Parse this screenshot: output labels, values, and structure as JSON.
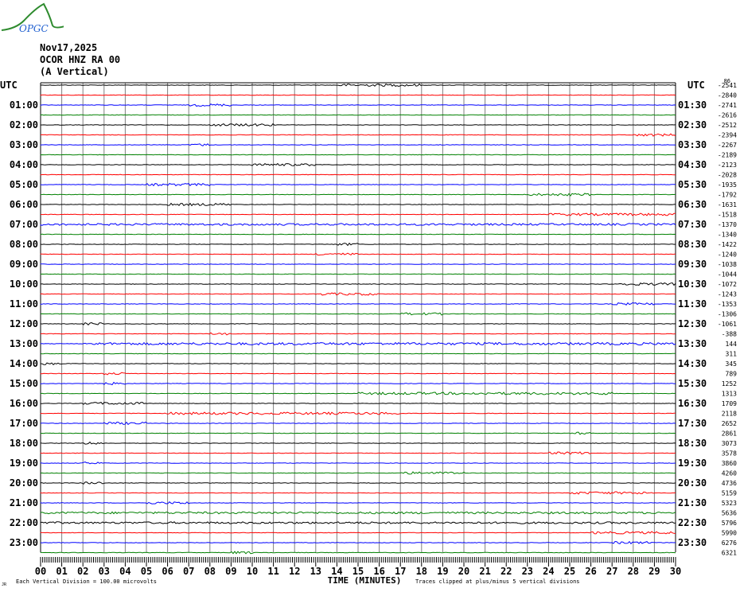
{
  "logo_text": "OPGC",
  "header": {
    "date": "Nov17,2025",
    "station": "OCOR HNZ RA 00",
    "component": "(A Vertical)",
    "utc_left": "UTC",
    "utc_right": "UTC"
  },
  "colors": {
    "trace_cycle": [
      "#000000",
      "#ff0000",
      "#0000ff",
      "#008000"
    ],
    "grid": "#808080"
  },
  "chart_data": {
    "type": "line",
    "title": "Nov17,2025 OCOR HNZ RA 00 (A Vertical)",
    "xlabel": "TIME (MINUTES)",
    "xlim": [
      0,
      30
    ],
    "x_ticks": [
      "00",
      "01",
      "02",
      "03",
      "04",
      "05",
      "06",
      "07",
      "08",
      "09",
      "10",
      "11",
      "12",
      "13",
      "14",
      "15",
      "16",
      "17",
      "18",
      "19",
      "20",
      "21",
      "22",
      "23",
      "24",
      "25",
      "26",
      "27",
      "28",
      "29",
      "30"
    ],
    "left_labels": [
      "01:00",
      "02:00",
      "03:00",
      "04:00",
      "05:00",
      "06:00",
      "07:00",
      "08:00",
      "09:00",
      "10:00",
      "11:00",
      "12:00",
      "13:00",
      "14:00",
      "15:00",
      "16:00",
      "17:00",
      "18:00",
      "19:00",
      "20:00",
      "21:00",
      "22:00",
      "23:00"
    ],
    "right_labels": [
      "01:30",
      "02:30",
      "03:30",
      "04:30",
      "05:30",
      "06:30",
      "07:30",
      "08:30",
      "09:30",
      "10:30",
      "11:30",
      "12:30",
      "13:30",
      "14:30",
      "15:30",
      "16:30",
      "17:30",
      "18:30",
      "19:30",
      "20:30",
      "21:30",
      "22:30",
      "23:30"
    ],
    "top_right_extra": "86",
    "trace_offsets": [
      -2541,
      -2840,
      -2741,
      -2616,
      -2512,
      -2394,
      -2267,
      -2189,
      -2123,
      -2028,
      -1935,
      -1792,
      -1631,
      -1518,
      -1370,
      -1340,
      -1422,
      -1240,
      -1038,
      -1044,
      -1072,
      -1243,
      -1353,
      -1306,
      -1061,
      -388,
      144,
      311,
      345,
      789,
      1252,
      1313,
      1709,
      2118,
      2652,
      2861,
      3073,
      3578,
      3860,
      4260,
      4736,
      5159,
      5323,
      5636,
      5796,
      5990,
      6276,
      6321
    ],
    "footer_left": "Each Vertical Division =  100.00 microvolts",
    "footer_right": "Traces clipped at plus/minus 5 vertical divisions",
    "corner_mark": "JR",
    "busy_traces": [
      14,
      43,
      44,
      48
    ],
    "events": [
      [
        0,
        14,
        18
      ],
      [
        2,
        7,
        9
      ],
      [
        4,
        8,
        11
      ],
      [
        5,
        28,
        30
      ],
      [
        6,
        7,
        8
      ],
      [
        8,
        10,
        13
      ],
      [
        10,
        5,
        8
      ],
      [
        11,
        23,
        26
      ],
      [
        12,
        6,
        9
      ],
      [
        13,
        24,
        30
      ],
      [
        16,
        14,
        15
      ],
      [
        17,
        13,
        15
      ],
      [
        20,
        27,
        30
      ],
      [
        21,
        13,
        16
      ],
      [
        22,
        27,
        29
      ],
      [
        23,
        17,
        19
      ],
      [
        24,
        2,
        3
      ],
      [
        25,
        8,
        9
      ],
      [
        26,
        2,
        30
      ],
      [
        28,
        0,
        1
      ],
      [
        29,
        3,
        4
      ],
      [
        30,
        3,
        4
      ],
      [
        31,
        15,
        27
      ],
      [
        32,
        2,
        5
      ],
      [
        33,
        6,
        17
      ],
      [
        34,
        3,
        5
      ],
      [
        35,
        25,
        26
      ],
      [
        36,
        2,
        3
      ],
      [
        37,
        24,
        26
      ],
      [
        38,
        2,
        3
      ],
      [
        39,
        17,
        20
      ],
      [
        40,
        2,
        3
      ],
      [
        41,
        25,
        29
      ],
      [
        42,
        5,
        7
      ],
      [
        45,
        26,
        30
      ],
      [
        46,
        27,
        29
      ],
      [
        47,
        9,
        10
      ]
    ]
  }
}
